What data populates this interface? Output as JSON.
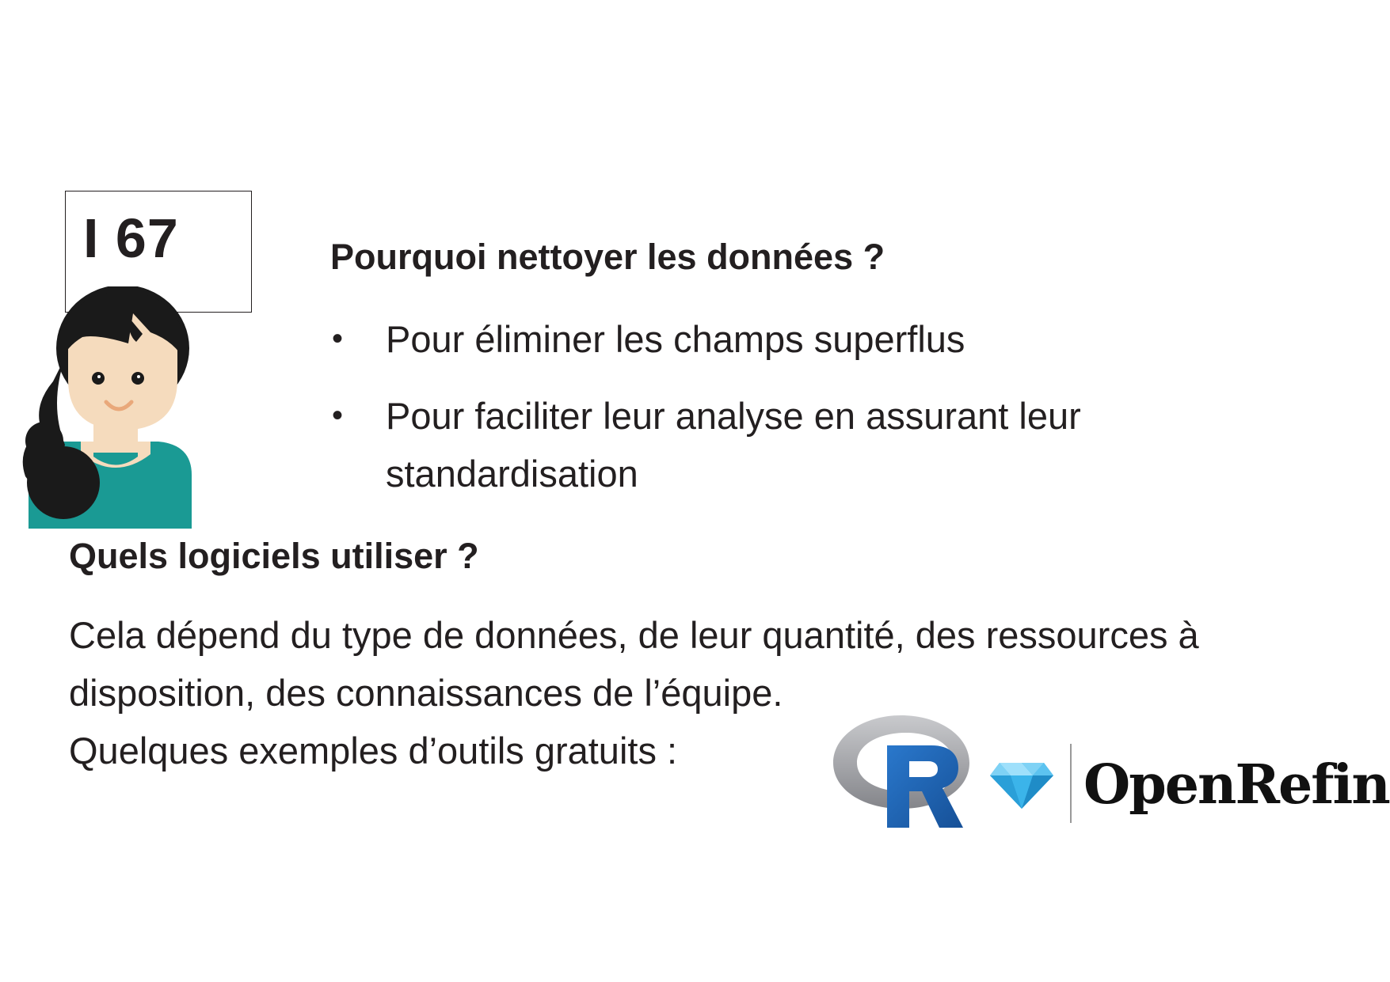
{
  "card": {
    "number": "I 67"
  },
  "section1": {
    "heading": "Pourquoi nettoyer les données ?",
    "bullets": [
      "Pour éliminer les champs superflus",
      "Pour faciliter leur analyse en assurant leur standardisation"
    ],
    "bullet_symbol": "•"
  },
  "section2": {
    "heading": "Quels logiciels utiliser ?",
    "paragraph": "Cela dépend du type de données, de leur quantité, des ressources à disposition, des connaissances de l’équipe.",
    "examples_intro": "Quelques exemples d’outils gratuits :"
  },
  "logos": {
    "r_logo_icon": "r-language-logo",
    "openrefine_icon": "diamond-icon",
    "openrefine_name": "OpenRefine"
  },
  "colors": {
    "text": "#231f20",
    "avatar_hair": "#1a1a1a",
    "avatar_skin": "#f5dbbd",
    "avatar_shirt": "#1a9a94",
    "r_blue": "#1e64b8",
    "r_ring": "#9fa0a5",
    "diamond_blue": "#3bb4ea"
  }
}
